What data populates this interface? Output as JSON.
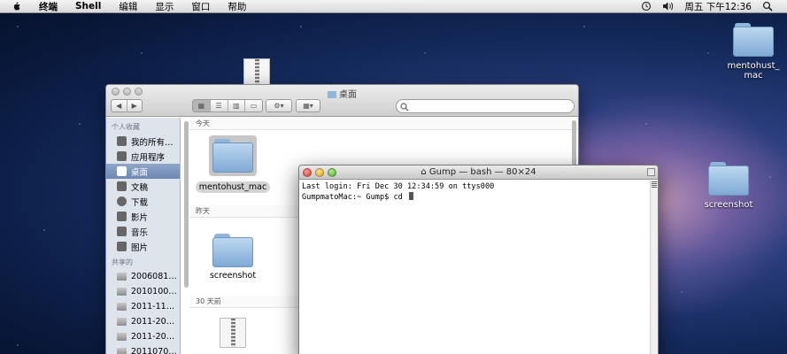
{
  "menubar": {
    "apple_icon": "apple-icon",
    "items": [
      "终端",
      "Shell",
      "编辑",
      "显示",
      "窗口",
      "帮助"
    ],
    "clock": "周五 下午12:36",
    "status_icons": [
      "time-machine-icon",
      "volume-icon"
    ]
  },
  "desktop": {
    "icons": [
      {
        "label": "mentohust_mac",
        "icon": "folder-icon"
      },
      {
        "label": "screenshot",
        "icon": "folder-icon"
      },
      {
        "label": "",
        "icon": "zip-archive-icon"
      }
    ]
  },
  "finder": {
    "title": "桌面",
    "sidebar": {
      "devices_header": "个人收藏",
      "items": [
        {
          "label": "我的所有…",
          "icon": "all-files-icon"
        },
        {
          "label": "应用程序",
          "icon": "applications-icon"
        },
        {
          "label": "桌面",
          "icon": "desktop-icon",
          "selected": true
        },
        {
          "label": "文稿",
          "icon": "documents-icon"
        },
        {
          "label": "下载",
          "icon": "downloads-icon"
        },
        {
          "label": "影片",
          "icon": "movies-icon"
        },
        {
          "label": "音乐",
          "icon": "music-icon"
        },
        {
          "label": "图片",
          "icon": "pictures-icon"
        }
      ],
      "shared_header": "共享的",
      "shared": [
        "2006081…",
        "2010100…",
        "2011-11…",
        "2011-20…",
        "2011-20…",
        "2011070…"
      ]
    },
    "sections": [
      {
        "label": "今天",
        "items": [
          {
            "label": "mentohust_mac",
            "selected": true
          }
        ]
      },
      {
        "label": "昨天",
        "items": [
          {
            "label": "screenshot"
          }
        ]
      },
      {
        "label": "30 天前",
        "items": [
          {
            "label": ""
          }
        ]
      }
    ]
  },
  "terminal": {
    "title": "Gump — bash — 80×24",
    "lines": [
      "Last login: Fri Dec 30 12:34:59 on ttys000",
      "GumpmatoMac:~ Gump$ cd "
    ]
  }
}
